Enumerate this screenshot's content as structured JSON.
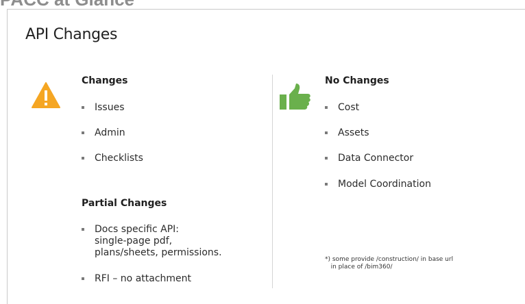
{
  "header": {
    "title": "PACC at Glance"
  },
  "slide": {
    "title": "API Changes",
    "changes": {
      "heading": "Changes",
      "items": [
        "Issues",
        "Admin",
        "Checklists"
      ]
    },
    "partial_changes": {
      "heading": "Partial Changes",
      "items": [
        "Docs specific API:\nsingle-page pdf,\nplans/sheets, permissions.",
        "RFI – no attachment"
      ]
    },
    "no_changes": {
      "heading": "No Changes",
      "items": [
        "Cost",
        "Assets",
        "Data Connector",
        "Model Coordination"
      ]
    },
    "footnote": "*) some provide /construction/ in base url\n   in place of /bim360/"
  },
  "icons": {
    "warning": {
      "name": "warning-icon",
      "color": "#f5a623"
    },
    "thumbs_up": {
      "name": "thumbs-up-icon",
      "color": "#6ab04c"
    }
  }
}
